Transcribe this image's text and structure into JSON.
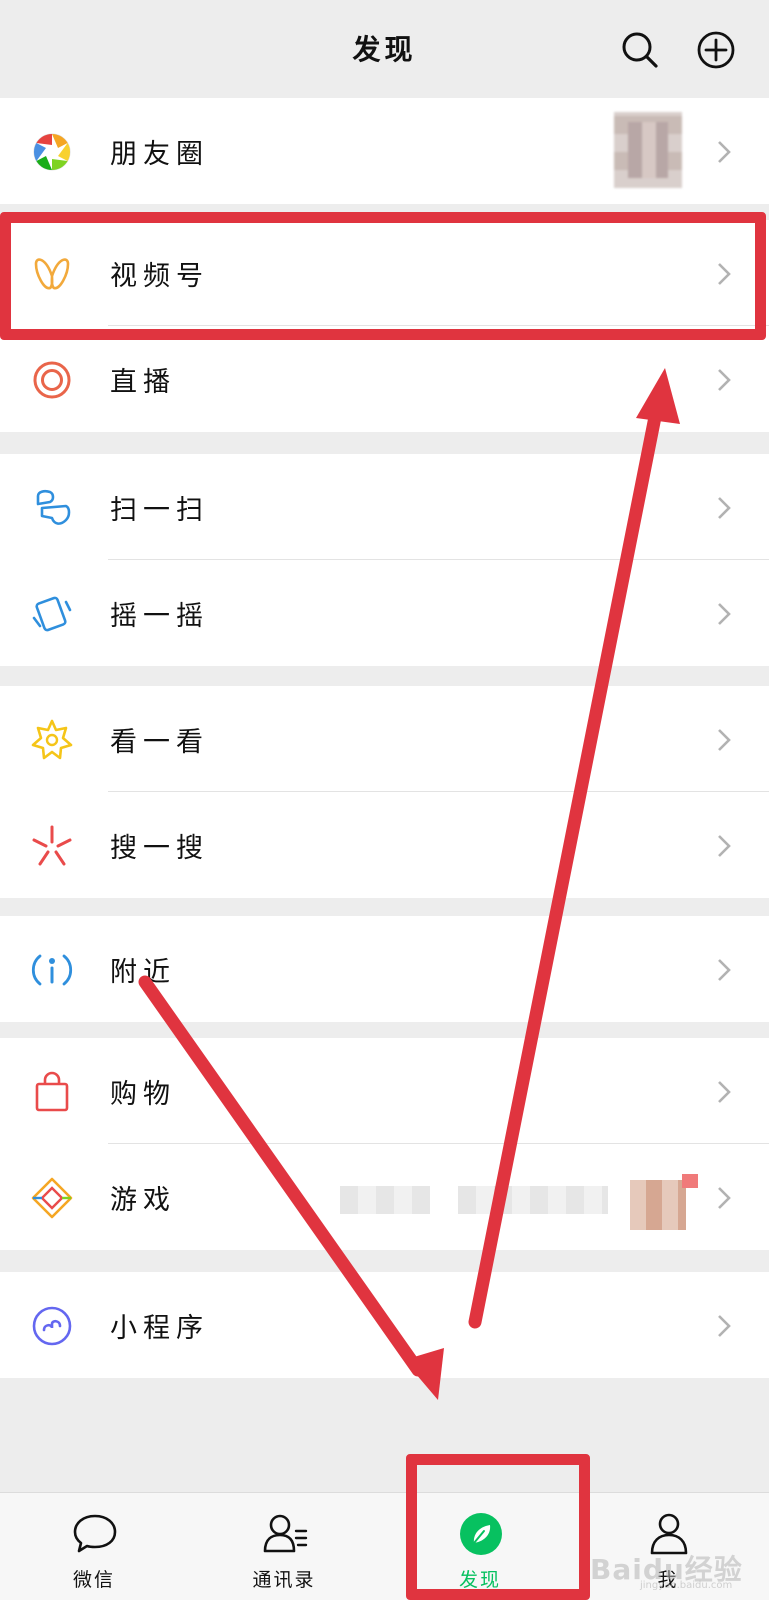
{
  "header": {
    "title": "发现",
    "search_icon": "search-icon",
    "add_icon": "plus-circle-icon"
  },
  "menu": {
    "moments": {
      "label": "朋友圈",
      "icon": "moments-aperture-icon"
    },
    "channels": {
      "label": "视频号",
      "icon": "channels-butterfly-icon"
    },
    "live": {
      "label": "直播",
      "icon": "live-ring-icon"
    },
    "scan": {
      "label": "扫一扫",
      "icon": "scan-icon"
    },
    "shake": {
      "label": "摇一摇",
      "icon": "shake-icon"
    },
    "top_stories": {
      "label": "看一看",
      "icon": "top-stories-icon"
    },
    "search": {
      "label": "搜一搜",
      "icon": "search-sparkle-icon"
    },
    "nearby": {
      "label": "附近",
      "icon": "nearby-icon"
    },
    "shopping": {
      "label": "购物",
      "icon": "shopping-bag-icon"
    },
    "games": {
      "label": "游戏",
      "icon": "games-diamond-icon"
    },
    "mini_programs": {
      "label": "小程序",
      "icon": "mini-programs-icon"
    }
  },
  "tabbar": {
    "chats": {
      "label": "微信",
      "icon": "chat-bubble-icon"
    },
    "contacts": {
      "label": "通讯录",
      "icon": "contacts-icon"
    },
    "discover": {
      "label": "发现",
      "icon": "compass-icon"
    },
    "me": {
      "label": "我",
      "icon": "person-icon"
    },
    "active_tab": "discover"
  },
  "watermark": {
    "text": "Baidu经验",
    "sub": "jingyan.baidu.com"
  },
  "colors": {
    "accent_green": "#07c160",
    "highlight_red": "#e0343f",
    "background": "#ededed"
  }
}
